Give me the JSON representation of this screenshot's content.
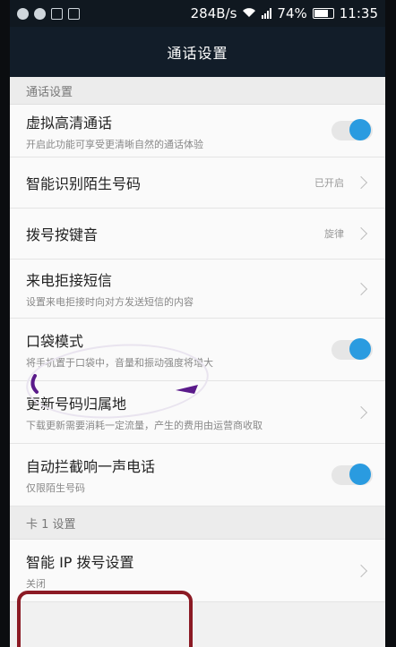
{
  "status_bar": {
    "speed": "284B/s",
    "signal": "⁴G",
    "battery": "74%",
    "time": "11:35"
  },
  "app_bar": {
    "title": "通话设置"
  },
  "sections": [
    {
      "header": "通话设置",
      "items": [
        {
          "title": "虚拟高清通话",
          "subtitle": "开启此功能可享受更清晰自然的通话体验",
          "control": "toggle",
          "on": true
        },
        {
          "title": "智能识别陌生号码",
          "value": "已开启",
          "control": "chevron"
        },
        {
          "title": "拨号按键音",
          "value": "旋律",
          "control": "chevron"
        },
        {
          "title": "来电拒接短信",
          "subtitle": "设置来电拒接时向对方发送短信的内容",
          "control": "chevron"
        },
        {
          "title": "口袋模式",
          "subtitle": "将手机置于口袋中，音量和振动强度将增大",
          "control": "toggle",
          "on": true
        },
        {
          "title": "更新号码归属地",
          "subtitle": "下载更新需要消耗一定流量，产生的费用由运营商收取",
          "control": "chevron"
        },
        {
          "title": "自动拦截响一声电话",
          "subtitle": "仅限陌生号码",
          "control": "toggle",
          "on": true
        }
      ]
    },
    {
      "header": "卡 1 设置",
      "items": [
        {
          "title": "智能 IP 拨号设置",
          "subtitle": "关闭",
          "control": "chevron"
        }
      ]
    }
  ],
  "colors": {
    "accent": "#2a9be0",
    "annotation_red": "#8b1a24",
    "annotation_purple": "#5a1a8a"
  }
}
